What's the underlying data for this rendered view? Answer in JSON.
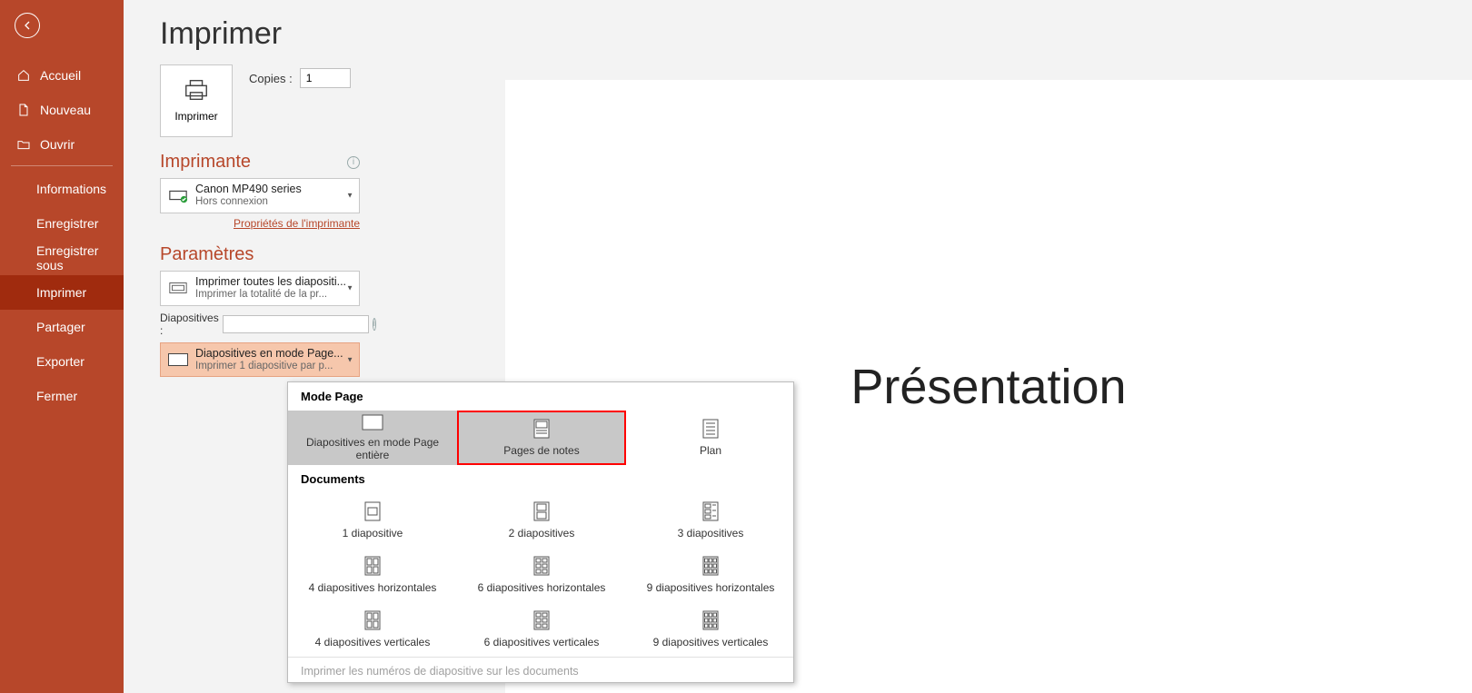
{
  "sidebar": {
    "accueil": "Accueil",
    "nouveau": "Nouveau",
    "ouvrir": "Ouvrir",
    "informations": "Informations",
    "enregistrer": "Enregistrer",
    "enregistrer_sous": "Enregistrer sous",
    "imprimer": "Imprimer",
    "partager": "Partager",
    "exporter": "Exporter",
    "fermer": "Fermer"
  },
  "page": {
    "title": "Imprimer",
    "print_button": "Imprimer",
    "copies_label": "Copies :",
    "copies_value": "1"
  },
  "printer": {
    "section_title": "Imprimante",
    "name": "Canon MP490 series",
    "status": "Hors connexion",
    "props_link": "Propriétés de l'imprimante"
  },
  "settings": {
    "section_title": "Paramètres",
    "print_all_main": "Imprimer toutes les diapositi...",
    "print_all_sub": "Imprimer la totalité de la pr...",
    "slides_label": "Diapositives :",
    "layout_main": "Diapositives en mode Page...",
    "layout_sub": "Imprimer 1 diapositive par p..."
  },
  "popup": {
    "mode_page": "Mode Page",
    "full_slides": "Diapositives en mode Page entière",
    "notes_pages": "Pages de notes",
    "plan": "Plan",
    "documents": "Documents",
    "d1": "1 diapositive",
    "d2": "2 diapositives",
    "d3": "3 diapositives",
    "d4h": "4 diapositives horizontales",
    "d6h": "6 diapositives horizontales",
    "d9h": "9 diapositives horizontales",
    "d4v": "4 diapositives verticales",
    "d6v": "6 diapositives verticales",
    "d9v": "9 diapositives verticales",
    "footer": "Imprimer les numéros de diapositive sur les documents"
  },
  "preview": {
    "title": "Présentation"
  }
}
